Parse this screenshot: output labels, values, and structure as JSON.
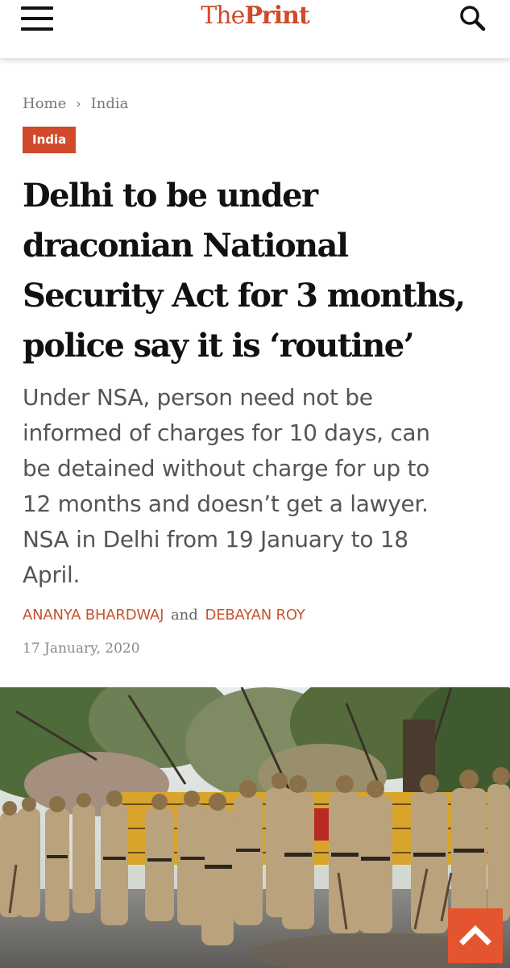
{
  "header": {
    "logo_prefix": "The",
    "logo_main": "Print",
    "menu_icon": "hamburger-menu-icon",
    "search_icon": "search-icon"
  },
  "breadcrumb": {
    "home": "Home",
    "separator_icon": "chevron-right-icon",
    "section": "India"
  },
  "category": "India",
  "article": {
    "headline_lines": [
      "Delhi to be under",
      "draconian National",
      "Security Act for 3 months,",
      "police say it is ‘routine’"
    ],
    "subheadline_lines": [
      "Under NSA, person need not be",
      "informed of charges for 10 days, can",
      "be detained without charge for up to",
      "12 months and doesn’t get a lawyer.",
      "NSA in Delhi from 19 January to 18",
      "April."
    ],
    "authors": [
      "ANANYA BHARDWAJ",
      "DEBAYAN ROY"
    ],
    "author_joiner": "and",
    "date": "17 January, 2020"
  },
  "hero_image": {
    "subject": "police-personnel-lined-up-at-barricades-photo"
  },
  "back_to_top": {
    "icon": "chevron-up-icon"
  },
  "colors": {
    "brand": "#d04a2b",
    "author": "#c8532f",
    "back_to_top": "#e4542f",
    "headline": "#111111",
    "subheadline": "#555555",
    "muted": "#777777"
  }
}
